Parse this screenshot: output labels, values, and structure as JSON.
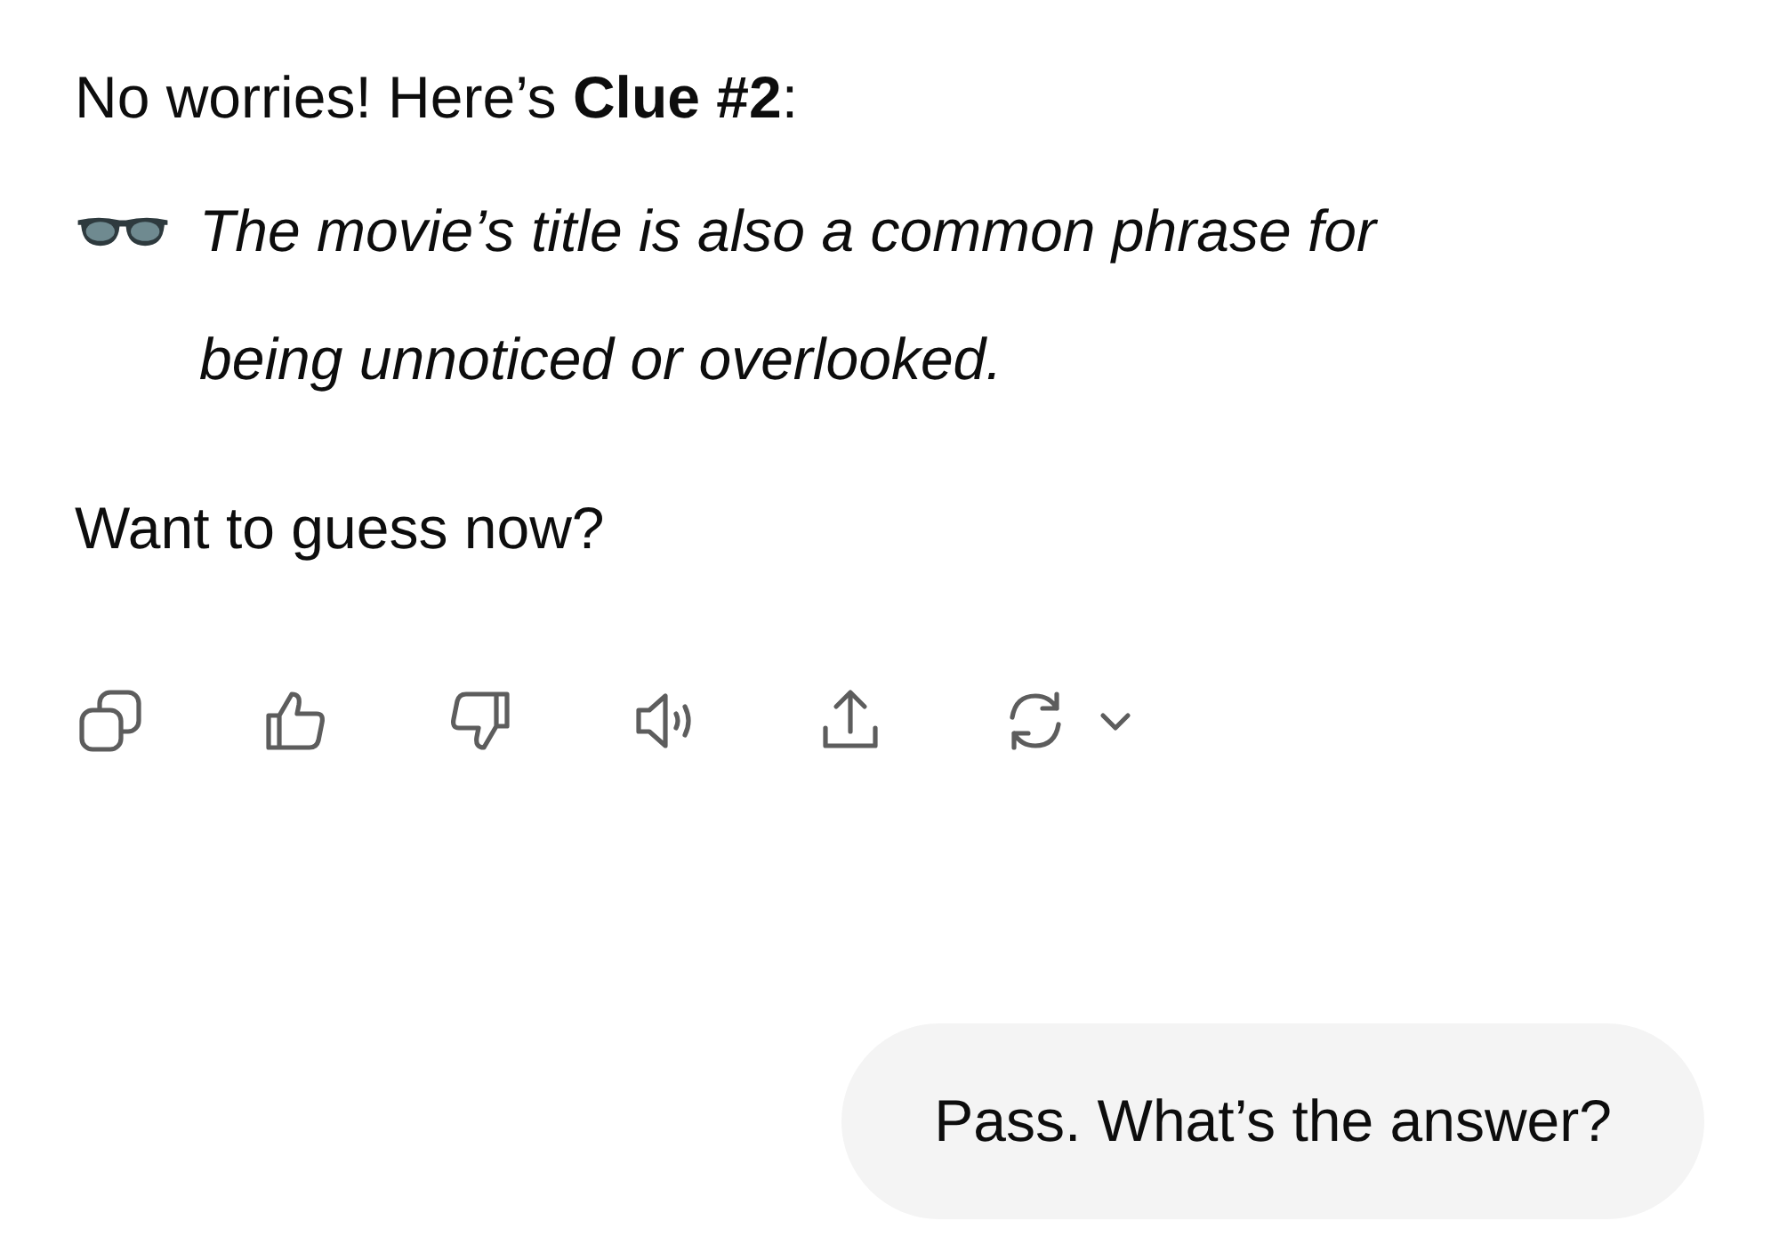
{
  "assistant_message": {
    "intro": "No worries! Here’s **Clue #2**:",
    "clue": "The movie’s title is also a common phrase for being unnoticed or overlooked.",
    "question": "Want to guess now?"
  },
  "actions": [
    {
      "kind": "copy"
    },
    {
      "kind": "like"
    },
    {
      "kind": "dislike"
    },
    {
      "kind": "speak"
    },
    {
      "kind": "share"
    },
    {
      "kind": "regenerate"
    }
  ],
  "user_message": {
    "text": "Pass. What’s the answer?"
  }
}
